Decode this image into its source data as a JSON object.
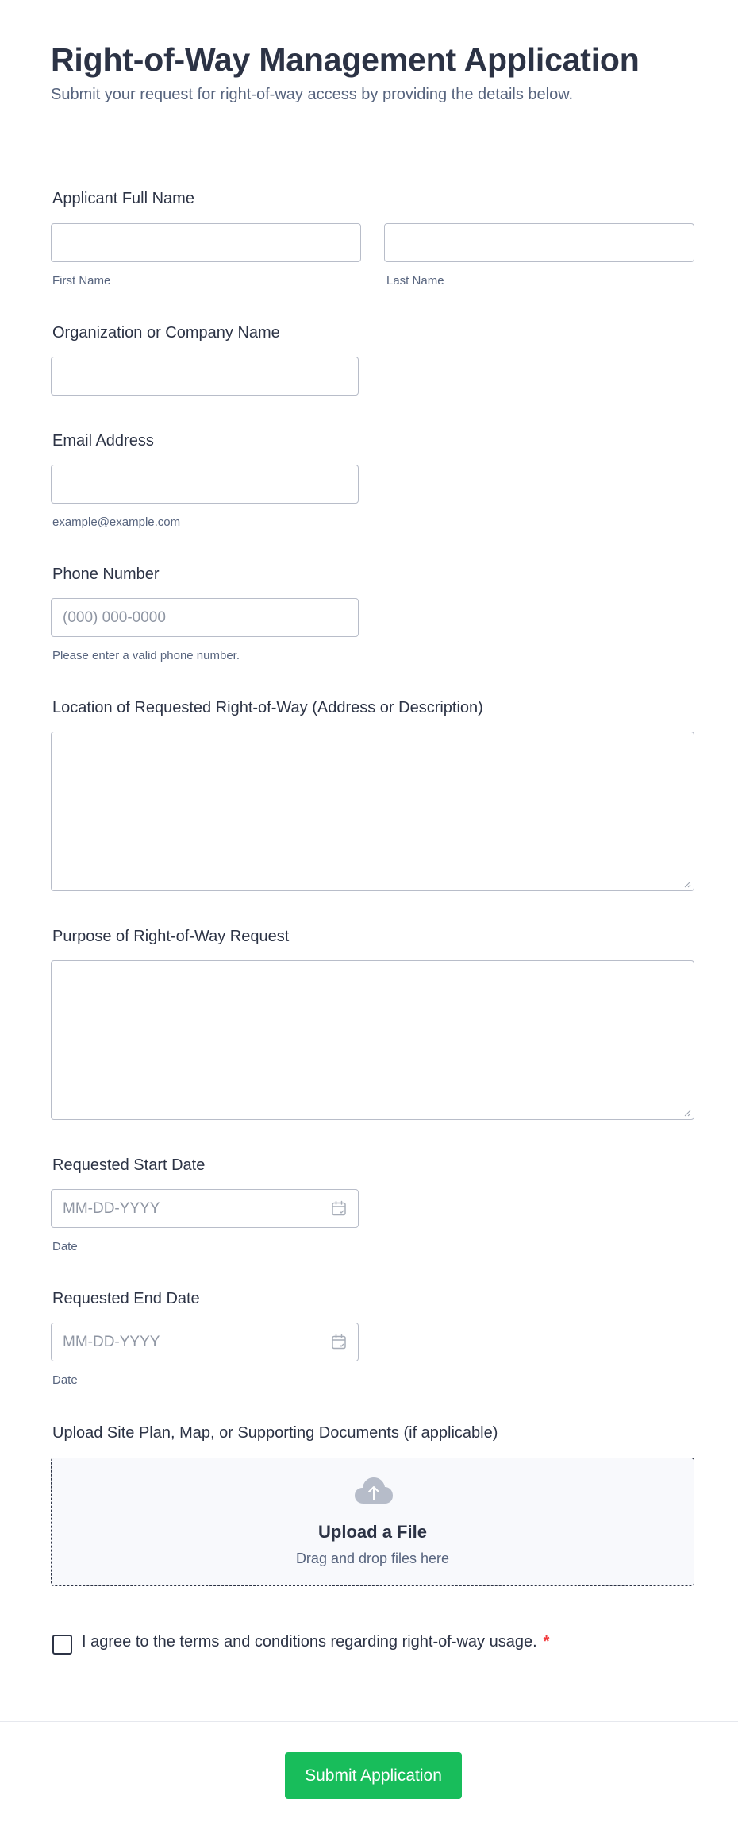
{
  "header": {
    "title": "Right-of-Way Management Application",
    "subtitle": "Submit your request for right-of-way access by providing the details below."
  },
  "fields": {
    "full_name": {
      "label": "Applicant Full Name",
      "first_sublabel": "First Name",
      "last_sublabel": "Last Name",
      "first_value": "",
      "last_value": ""
    },
    "organization": {
      "label": "Organization or Company Name",
      "value": ""
    },
    "email": {
      "label": "Email Address",
      "value": "",
      "sublabel": "example@example.com"
    },
    "phone": {
      "label": "Phone Number",
      "placeholder": "(000) 000-0000",
      "sublabel": "Please enter a valid phone number."
    },
    "location": {
      "label": "Location of Requested Right-of-Way (Address or Description)",
      "value": ""
    },
    "purpose": {
      "label": "Purpose of Right-of-Way Request",
      "value": ""
    },
    "start_date": {
      "label": "Requested Start Date",
      "placeholder": "MM-DD-YYYY",
      "sublabel": "Date",
      "icon": "calendar-icon"
    },
    "end_date": {
      "label": "Requested End Date",
      "placeholder": "MM-DD-YYYY",
      "sublabel": "Date",
      "icon": "calendar-icon"
    },
    "upload": {
      "label": "Upload Site Plan, Map, or Supporting Documents (if applicable)",
      "title": "Upload a File",
      "subtitle": "Drag and drop files here",
      "icon": "cloud-upload-icon"
    },
    "terms": {
      "label": "I agree to the terms and conditions regarding right-of-way usage.",
      "required_mark": "*",
      "checked": false
    }
  },
  "submit": {
    "label": "Submit Application",
    "color": "#18bd5b"
  },
  "colors": {
    "text": "#2c3345",
    "muted": "#57647e",
    "required": "#f23a3c",
    "border": "#b8bdc9"
  }
}
